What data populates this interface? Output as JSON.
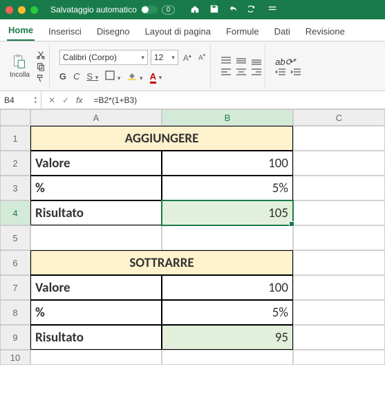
{
  "titlebar": {
    "autosave_label": "Salvataggio automatico",
    "doc_badge": "0"
  },
  "tabs": {
    "home": "Home",
    "insert": "Inserisci",
    "draw": "Disegno",
    "page_layout": "Layout di pagina",
    "formulas": "Formule",
    "data": "Dati",
    "review": "Revisione"
  },
  "ribbon": {
    "paste_label": "Incolla",
    "font_name": "Calibri (Corpo)",
    "font_size": "12",
    "bold": "G",
    "italic": "C",
    "strike": "S"
  },
  "formula_bar": {
    "cell_ref": "B4",
    "fx_label": "fx",
    "formula": "=B2*(1+B3)"
  },
  "columns": {
    "a": "A",
    "b": "B",
    "c": "C"
  },
  "rows": {
    "r1": "1",
    "r2": "2",
    "r3": "3",
    "r4": "4",
    "r5": "5",
    "r6": "6",
    "r7": "7",
    "r8": "8",
    "r9": "9",
    "r10": "10"
  },
  "sheet": {
    "title1": "AGGIUNGERE",
    "label_value": "Valore",
    "label_pct": "%",
    "label_result": "Risultato",
    "add_value": "100",
    "add_pct": "5%",
    "add_result": "105",
    "title2": "SOTTRARRE",
    "sub_value": "100",
    "sub_pct": "5%",
    "sub_result": "95"
  },
  "colors": {
    "accent": "#197b4a",
    "title_bg": "#fdf2cc",
    "result_bg": "#e2efda"
  }
}
